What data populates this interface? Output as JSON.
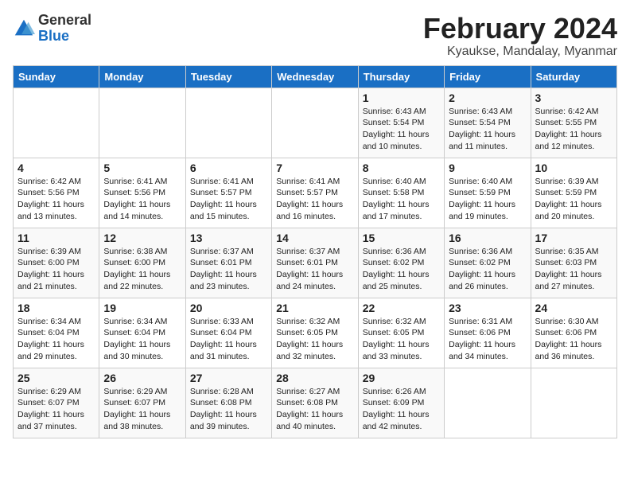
{
  "logo": {
    "general": "General",
    "blue": "Blue"
  },
  "title": {
    "month_year": "February 2024",
    "location": "Kyaukse, Mandalay, Myanmar"
  },
  "weekdays": [
    "Sunday",
    "Monday",
    "Tuesday",
    "Wednesday",
    "Thursday",
    "Friday",
    "Saturday"
  ],
  "weeks": [
    [
      {
        "day": "",
        "info": ""
      },
      {
        "day": "",
        "info": ""
      },
      {
        "day": "",
        "info": ""
      },
      {
        "day": "",
        "info": ""
      },
      {
        "day": "1",
        "info": "Sunrise: 6:43 AM\nSunset: 5:54 PM\nDaylight: 11 hours\nand 10 minutes."
      },
      {
        "day": "2",
        "info": "Sunrise: 6:43 AM\nSunset: 5:54 PM\nDaylight: 11 hours\nand 11 minutes."
      },
      {
        "day": "3",
        "info": "Sunrise: 6:42 AM\nSunset: 5:55 PM\nDaylight: 11 hours\nand 12 minutes."
      }
    ],
    [
      {
        "day": "4",
        "info": "Sunrise: 6:42 AM\nSunset: 5:56 PM\nDaylight: 11 hours\nand 13 minutes."
      },
      {
        "day": "5",
        "info": "Sunrise: 6:41 AM\nSunset: 5:56 PM\nDaylight: 11 hours\nand 14 minutes."
      },
      {
        "day": "6",
        "info": "Sunrise: 6:41 AM\nSunset: 5:57 PM\nDaylight: 11 hours\nand 15 minutes."
      },
      {
        "day": "7",
        "info": "Sunrise: 6:41 AM\nSunset: 5:57 PM\nDaylight: 11 hours\nand 16 minutes."
      },
      {
        "day": "8",
        "info": "Sunrise: 6:40 AM\nSunset: 5:58 PM\nDaylight: 11 hours\nand 17 minutes."
      },
      {
        "day": "9",
        "info": "Sunrise: 6:40 AM\nSunset: 5:59 PM\nDaylight: 11 hours\nand 19 minutes."
      },
      {
        "day": "10",
        "info": "Sunrise: 6:39 AM\nSunset: 5:59 PM\nDaylight: 11 hours\nand 20 minutes."
      }
    ],
    [
      {
        "day": "11",
        "info": "Sunrise: 6:39 AM\nSunset: 6:00 PM\nDaylight: 11 hours\nand 21 minutes."
      },
      {
        "day": "12",
        "info": "Sunrise: 6:38 AM\nSunset: 6:00 PM\nDaylight: 11 hours\nand 22 minutes."
      },
      {
        "day": "13",
        "info": "Sunrise: 6:37 AM\nSunset: 6:01 PM\nDaylight: 11 hours\nand 23 minutes."
      },
      {
        "day": "14",
        "info": "Sunrise: 6:37 AM\nSunset: 6:01 PM\nDaylight: 11 hours\nand 24 minutes."
      },
      {
        "day": "15",
        "info": "Sunrise: 6:36 AM\nSunset: 6:02 PM\nDaylight: 11 hours\nand 25 minutes."
      },
      {
        "day": "16",
        "info": "Sunrise: 6:36 AM\nSunset: 6:02 PM\nDaylight: 11 hours\nand 26 minutes."
      },
      {
        "day": "17",
        "info": "Sunrise: 6:35 AM\nSunset: 6:03 PM\nDaylight: 11 hours\nand 27 minutes."
      }
    ],
    [
      {
        "day": "18",
        "info": "Sunrise: 6:34 AM\nSunset: 6:04 PM\nDaylight: 11 hours\nand 29 minutes."
      },
      {
        "day": "19",
        "info": "Sunrise: 6:34 AM\nSunset: 6:04 PM\nDaylight: 11 hours\nand 30 minutes."
      },
      {
        "day": "20",
        "info": "Sunrise: 6:33 AM\nSunset: 6:04 PM\nDaylight: 11 hours\nand 31 minutes."
      },
      {
        "day": "21",
        "info": "Sunrise: 6:32 AM\nSunset: 6:05 PM\nDaylight: 11 hours\nand 32 minutes."
      },
      {
        "day": "22",
        "info": "Sunrise: 6:32 AM\nSunset: 6:05 PM\nDaylight: 11 hours\nand 33 minutes."
      },
      {
        "day": "23",
        "info": "Sunrise: 6:31 AM\nSunset: 6:06 PM\nDaylight: 11 hours\nand 34 minutes."
      },
      {
        "day": "24",
        "info": "Sunrise: 6:30 AM\nSunset: 6:06 PM\nDaylight: 11 hours\nand 36 minutes."
      }
    ],
    [
      {
        "day": "25",
        "info": "Sunrise: 6:29 AM\nSunset: 6:07 PM\nDaylight: 11 hours\nand 37 minutes."
      },
      {
        "day": "26",
        "info": "Sunrise: 6:29 AM\nSunset: 6:07 PM\nDaylight: 11 hours\nand 38 minutes."
      },
      {
        "day": "27",
        "info": "Sunrise: 6:28 AM\nSunset: 6:08 PM\nDaylight: 11 hours\nand 39 minutes."
      },
      {
        "day": "28",
        "info": "Sunrise: 6:27 AM\nSunset: 6:08 PM\nDaylight: 11 hours\nand 40 minutes."
      },
      {
        "day": "29",
        "info": "Sunrise: 6:26 AM\nSunset: 6:09 PM\nDaylight: 11 hours\nand 42 minutes."
      },
      {
        "day": "",
        "info": ""
      },
      {
        "day": "",
        "info": ""
      }
    ]
  ]
}
